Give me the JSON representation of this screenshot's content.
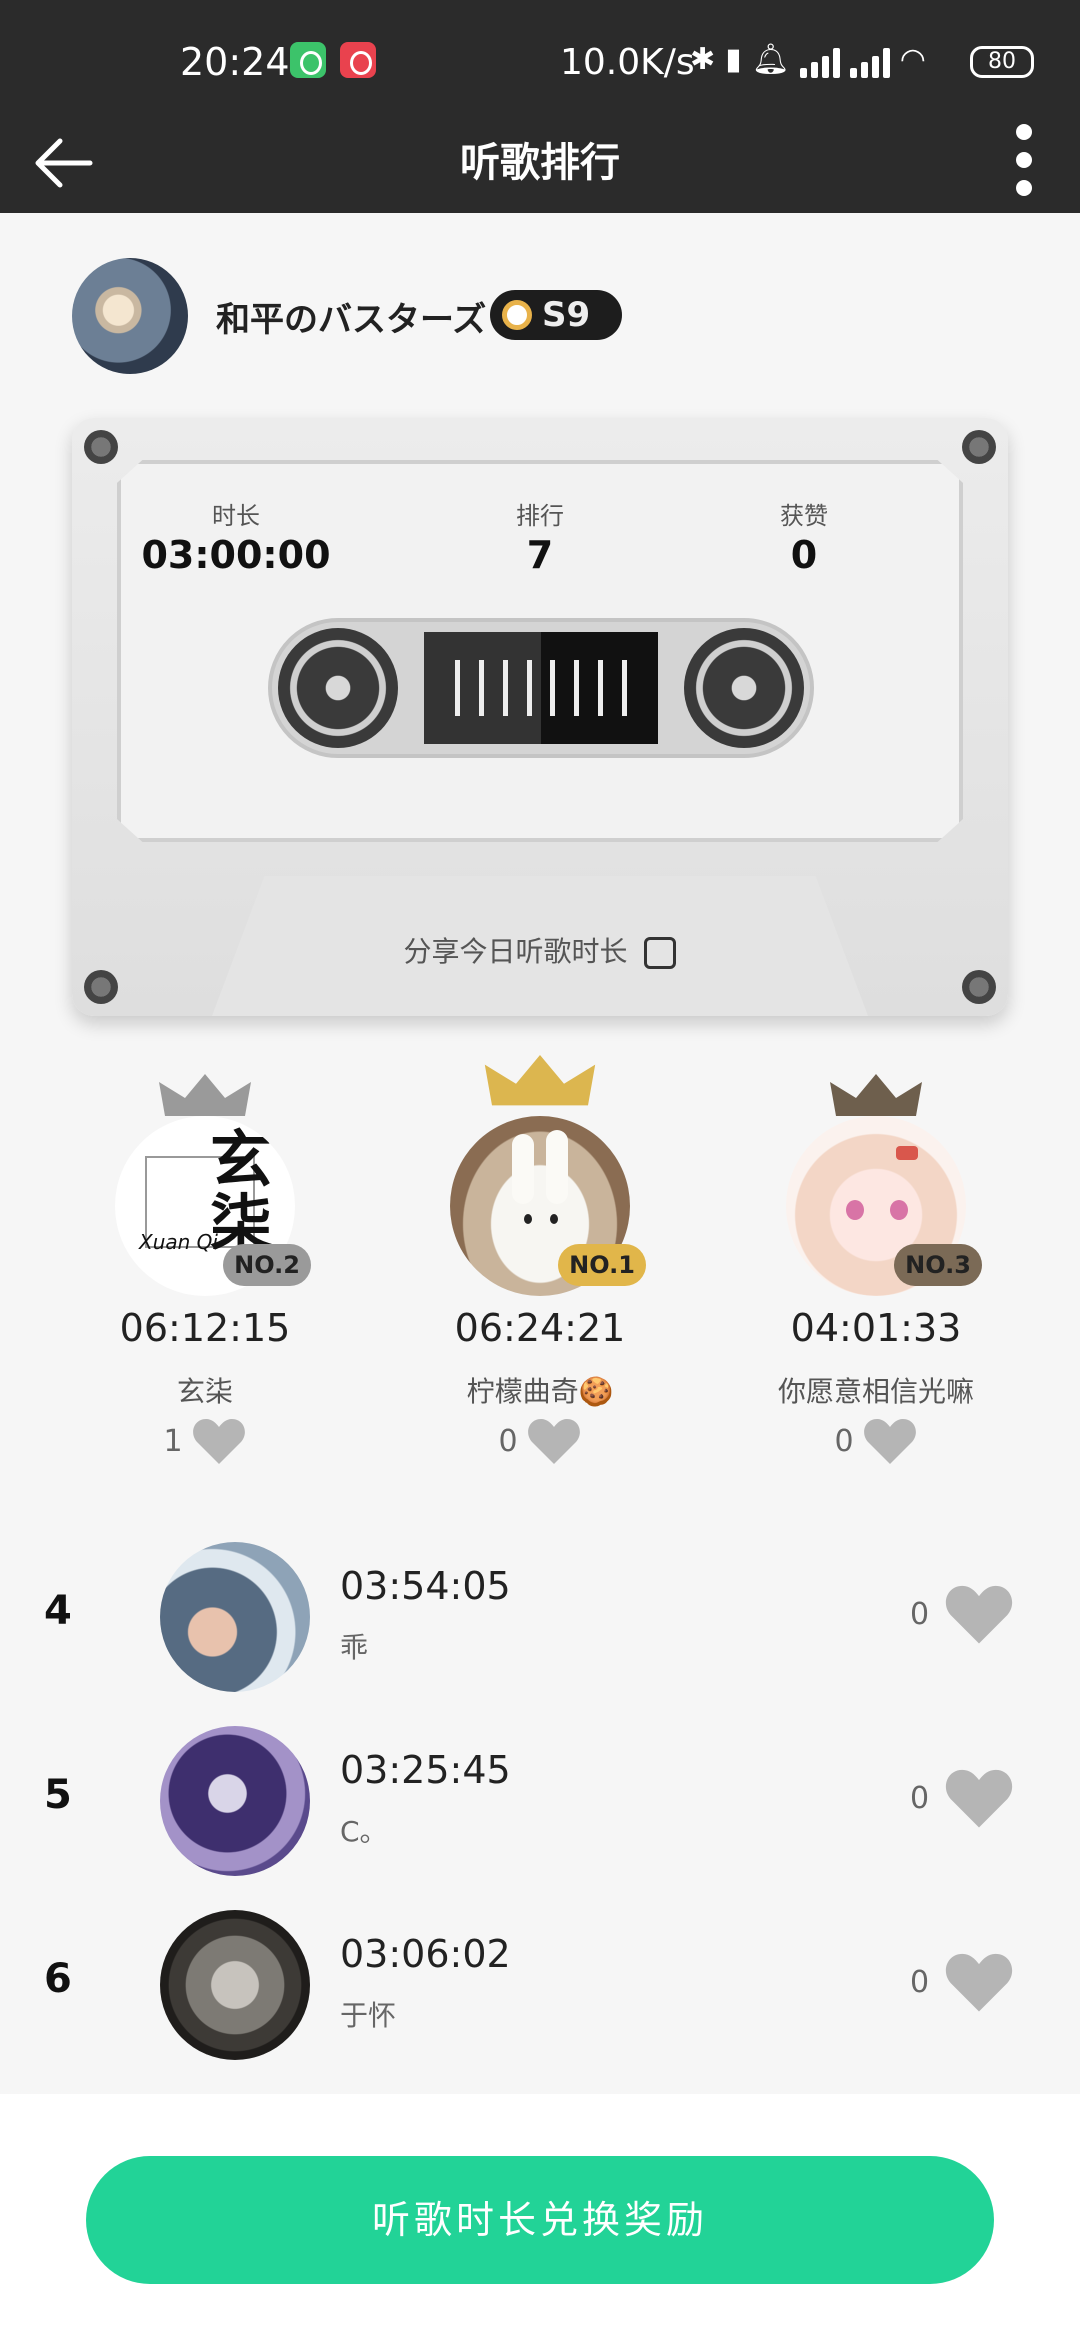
{
  "status_bar": {
    "time": "20:24",
    "network_speed": "10.0K/s",
    "battery": "80"
  },
  "header": {
    "title": "听歌排行",
    "back_icon": "arrow-left-icon",
    "more_icon": "more-vertical-icon"
  },
  "profile": {
    "name": "和平のバスターズ",
    "level": "S9"
  },
  "cassette": {
    "stats": [
      {
        "label": "时长",
        "value": "03:00:00"
      },
      {
        "label": "排行",
        "value": "7"
      },
      {
        "label": "获赞",
        "value": "0"
      }
    ],
    "share_label": "分享今日听歌时长"
  },
  "top3": [
    {
      "rank": "NO.1",
      "time": "06:24:21",
      "name": "柠檬曲奇🍪",
      "likes": "0",
      "crown_color": "#dcb64f"
    },
    {
      "rank": "NO.2",
      "time": "06:12:15",
      "name": "玄柒",
      "likes": "1",
      "crown_color": "#9a9a9a",
      "avatar_text": "玄柒",
      "avatar_subtext": "Xuan Qi"
    },
    {
      "rank": "NO.3",
      "time": "04:01:33",
      "name": "你愿意相信光嘛",
      "likes": "0",
      "crown_color": "#6e5f4d"
    }
  ],
  "list": [
    {
      "rank": "4",
      "time": "03:54:05",
      "name": "乖",
      "likes": "0"
    },
    {
      "rank": "5",
      "time": "03:25:45",
      "name": "C。",
      "likes": "0"
    },
    {
      "rank": "6",
      "time": "03:06:02",
      "name": "于怀",
      "likes": "0"
    }
  ],
  "footer": {
    "button_label": "听歌时长兑换奖励"
  },
  "colors": {
    "accent": "#22d397",
    "header_bg": "#2b2b2b",
    "gold": "#dcb64f",
    "silver": "#9a9a9a",
    "bronze": "#6e5f4d"
  }
}
